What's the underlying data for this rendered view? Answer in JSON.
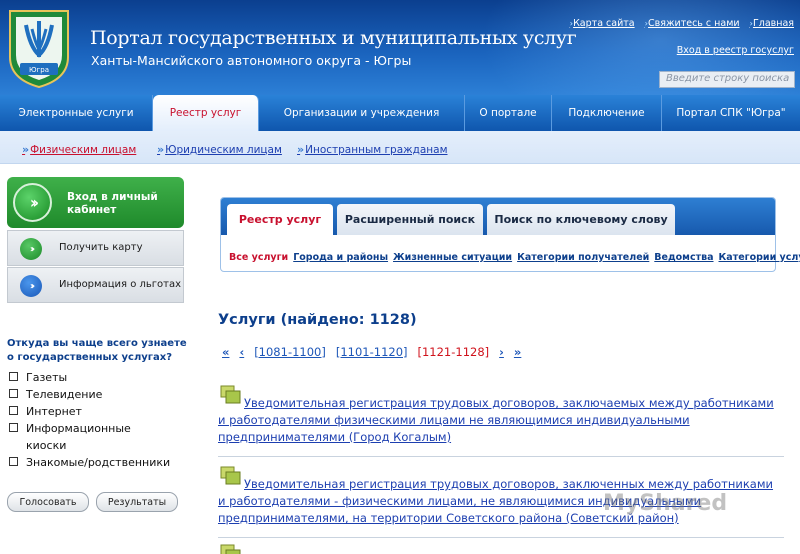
{
  "header": {
    "title": "Портал государственных и муниципальных услуг",
    "subtitle": "Ханты-Мансийского автономного округа - Югры",
    "emblem_text": "Югра",
    "links": [
      "Карта сайта",
      "Свяжитесь с нами",
      "Главная"
    ],
    "registry_login": "Вход в реестр госуслуг",
    "search_placeholder": "Введите строку поиска"
  },
  "main_nav": {
    "items": [
      "Электронные услуги",
      "Реестр услуг",
      "Организации и учреждения",
      "О портале",
      "Подключение",
      "Портал СПК \"Югра\""
    ],
    "active": "Реестр услуг"
  },
  "sub_nav": {
    "items": [
      "Физическим лицам",
      "Юридическим лицам",
      "Иностранным гражданам"
    ],
    "active": "Физическим лицам"
  },
  "sidebar": {
    "login_button": "Вход в личный кабинет",
    "get_card_button": "Получить карту",
    "benefits_button": "Информация о льготах",
    "poll": {
      "question": "Откуда вы чаще всего узнаете о государственных услугах?",
      "options": [
        "Газеты",
        "Телевидение",
        "Интернет",
        "Информационные киоски",
        "Знакомые/родственники"
      ],
      "vote_button": "Голосовать",
      "results_button": "Результаты"
    }
  },
  "content": {
    "tabs": [
      "Реестр услуг",
      "Расширенный поиск",
      "Поиск по ключевому слову"
    ],
    "active_tab": "Реестр услуг",
    "filters": [
      "Все услуги",
      "Города и районы",
      "Жизненные ситуации",
      "Категории получателей",
      "Ведомства",
      "Категории услуг"
    ],
    "active_filter": "Все услуги",
    "results_title": "Услуги (найдено: 1128)",
    "pager": {
      "first": "«",
      "prev": "‹",
      "pages": [
        "[1081-1100]",
        "[1101-1120]",
        "[1121-1128]"
      ],
      "current": "[1121-1128]",
      "next": "›",
      "last": "»"
    },
    "results": [
      "Уведомительная регистрация трудовых договоров, заключаемых между работниками и работодателями физическими лицами не являющимися индивидуальными предпринимателями (Город Когалым)",
      "Уведомительная регистрация трудовых договоров, заключенных между работниками и работодателями - физическими лицами, не являющимися индивидуальными предпринимателями, на территории Советского района (Советский район)"
    ]
  },
  "watermark": "MyShared",
  "colors": {
    "header_blue": "#1a63bd",
    "link_blue": "#1d3fb0",
    "active_red": "#c8102e",
    "green_button": "#2a9a36"
  }
}
